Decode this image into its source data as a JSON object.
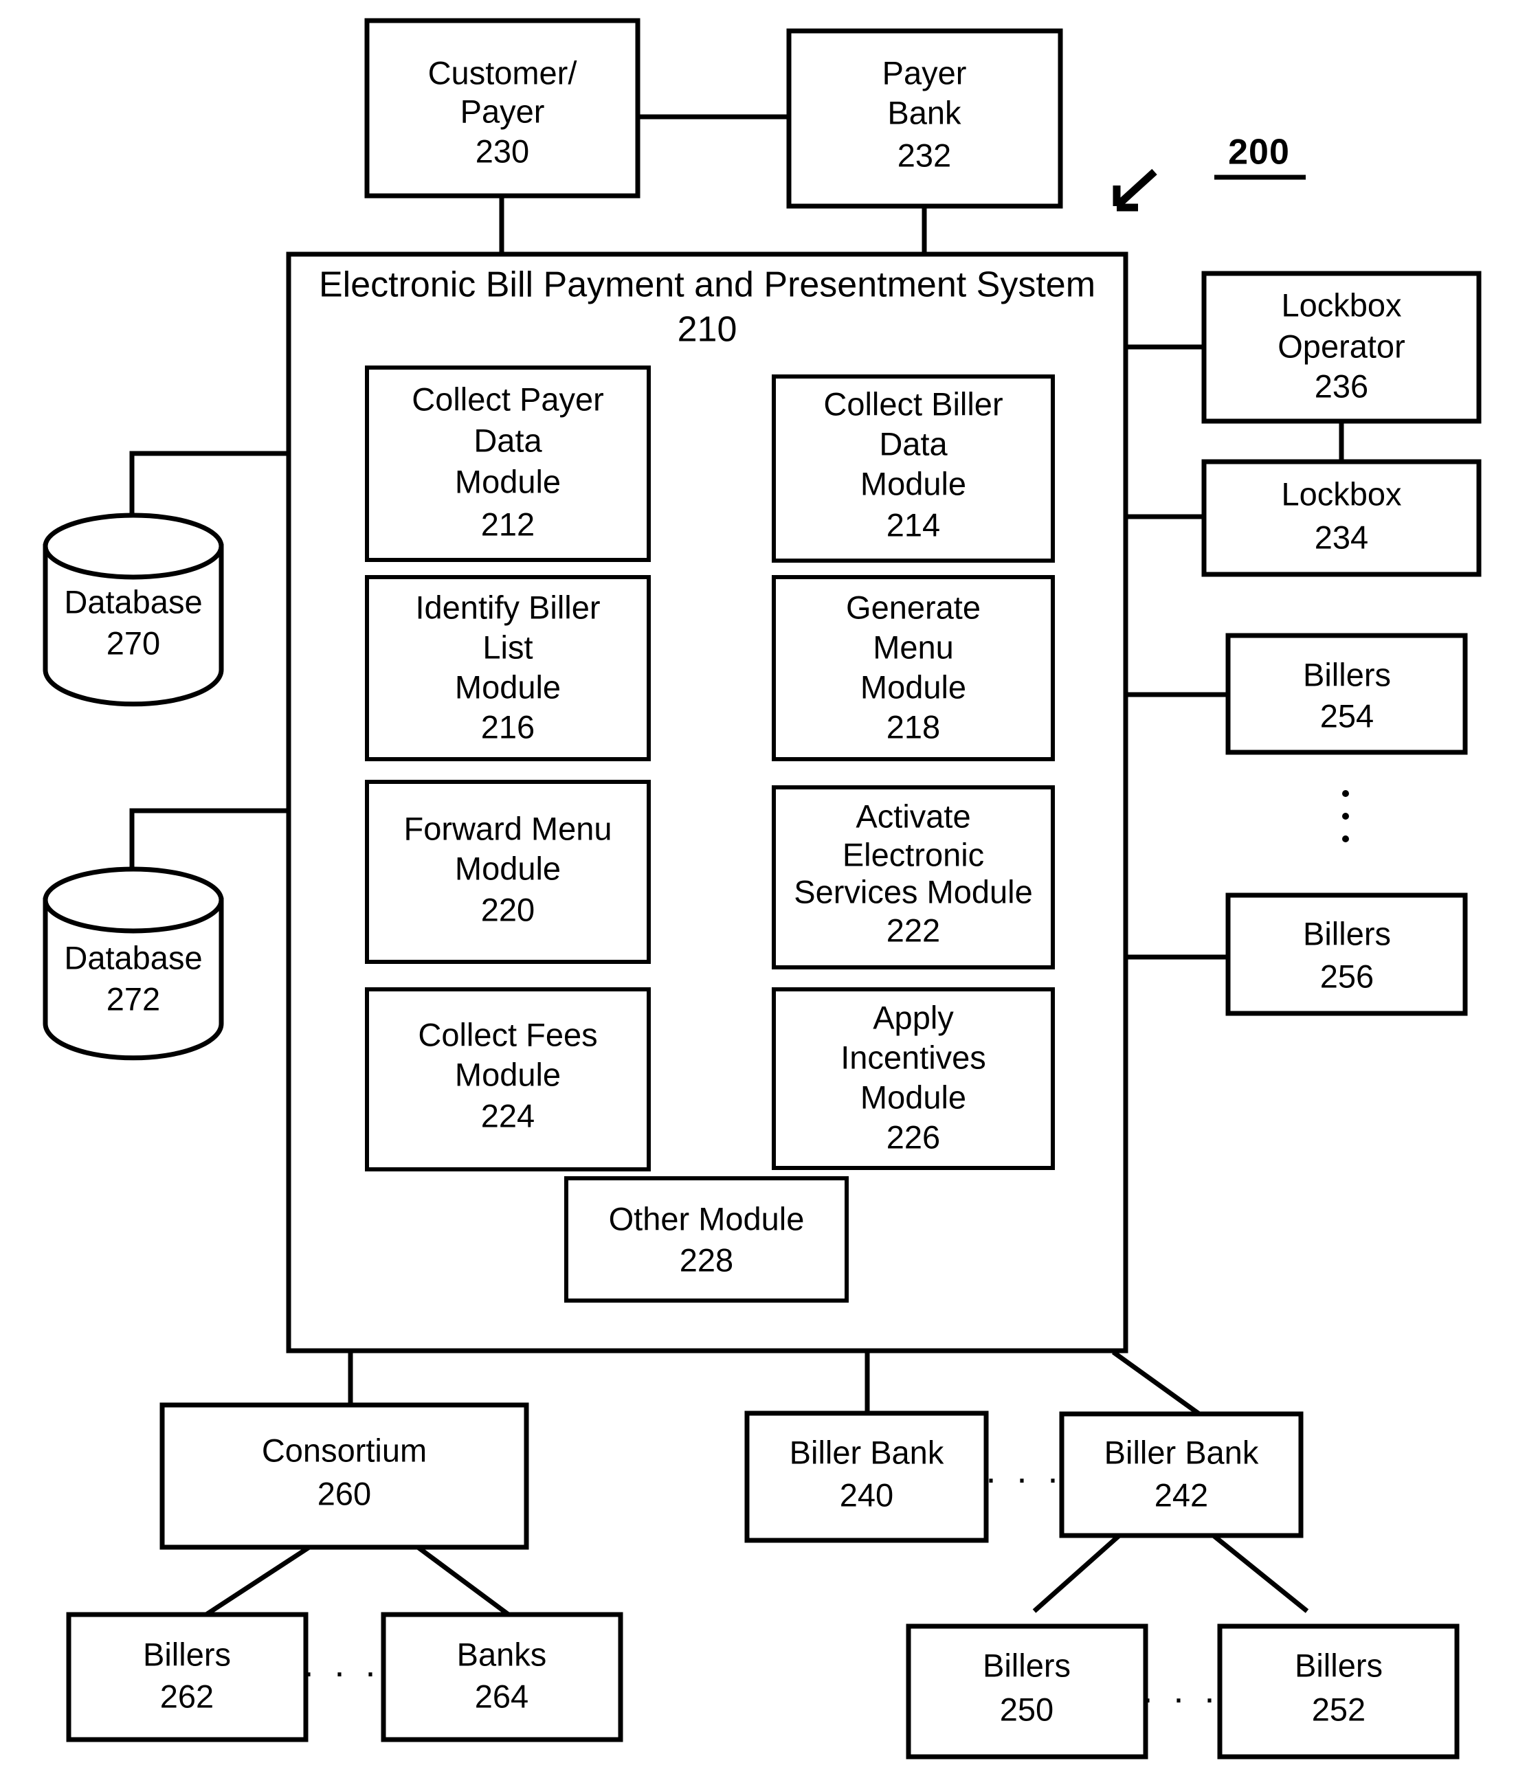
{
  "figure": {
    "reference_numeral": "200",
    "arrow": "down-left-arrow"
  },
  "top_entities": [
    {
      "id": "customer-payer",
      "lines": [
        "Customer/",
        "Payer"
      ],
      "ref": "230"
    },
    {
      "id": "payer-bank",
      "lines": [
        "Payer",
        "Bank"
      ],
      "ref": "232"
    }
  ],
  "system": {
    "title": "Electronic Bill Payment and Presentment System",
    "ref": "210",
    "modules": [
      {
        "id": "collect-payer-data-module",
        "lines": [
          "Collect Payer",
          "Data",
          "Module"
        ],
        "ref": "212"
      },
      {
        "id": "collect-biller-data-module",
        "lines": [
          "Collect Biller",
          "Data",
          "Module"
        ],
        "ref": "214"
      },
      {
        "id": "identify-biller-list-module",
        "lines": [
          "Identify Biller",
          "List",
          "Module"
        ],
        "ref": "216"
      },
      {
        "id": "generate-menu-module",
        "lines": [
          "Generate",
          "Menu",
          "Module"
        ],
        "ref": "218"
      },
      {
        "id": "forward-menu-module",
        "lines": [
          "Forward Menu",
          "Module"
        ],
        "ref": "220"
      },
      {
        "id": "activate-electronic-services-module",
        "lines": [
          "Activate",
          "Electronic",
          "Services Module"
        ],
        "ref": "222"
      },
      {
        "id": "collect-fees-module",
        "lines": [
          "Collect Fees",
          "Module"
        ],
        "ref": "224"
      },
      {
        "id": "apply-incentives-module",
        "lines": [
          "Apply",
          "Incentives",
          "Module"
        ],
        "ref": "226"
      },
      {
        "id": "other-module",
        "lines": [
          "Other Module"
        ],
        "ref": "228"
      }
    ]
  },
  "databases": [
    {
      "id": "database-270",
      "label": "Database",
      "ref": "270"
    },
    {
      "id": "database-272",
      "label": "Database",
      "ref": "272"
    }
  ],
  "right_entities": [
    {
      "id": "lockbox-operator",
      "lines": [
        "Lockbox",
        "Operator"
      ],
      "ref": "236"
    },
    {
      "id": "lockbox",
      "lines": [
        "Lockbox"
      ],
      "ref": "234"
    },
    {
      "id": "billers-254",
      "lines": [
        "Billers"
      ],
      "ref": "254"
    },
    {
      "id": "billers-256",
      "lines": [
        "Billers"
      ],
      "ref": "256"
    }
  ],
  "bottom_entities": [
    {
      "id": "consortium",
      "lines": [
        "Consortium"
      ],
      "ref": "260"
    },
    {
      "id": "billers-262",
      "lines": [
        "Billers"
      ],
      "ref": "262"
    },
    {
      "id": "banks-264",
      "lines": [
        "Banks"
      ],
      "ref": "264"
    },
    {
      "id": "biller-bank-240",
      "lines": [
        "Biller Bank"
      ],
      "ref": "240"
    },
    {
      "id": "biller-bank-242",
      "lines": [
        "Biller Bank"
      ],
      "ref": "242"
    },
    {
      "id": "billers-250",
      "lines": [
        "Billers"
      ],
      "ref": "250"
    },
    {
      "id": "billers-252",
      "lines": [
        "Billers"
      ],
      "ref": "252"
    }
  ],
  "ellipses": {
    "vertical_right": "⋮",
    "horizontal": "· · ·"
  },
  "colors": {
    "stroke": "#000000",
    "background": "#ffffff"
  }
}
